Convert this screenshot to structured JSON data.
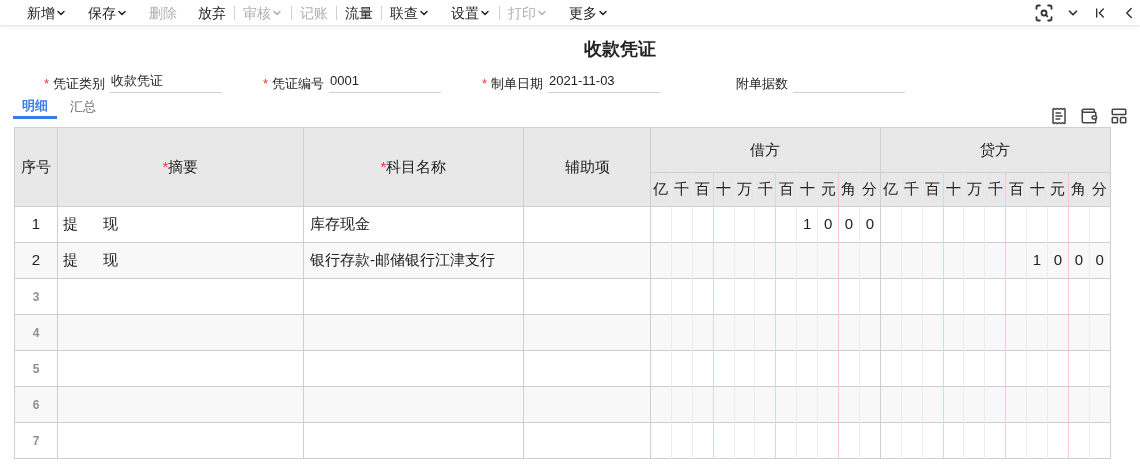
{
  "toolbar": [
    {
      "label": "新增",
      "caret": true,
      "disabled": false,
      "divider": false
    },
    {
      "label": "保存",
      "caret": true,
      "disabled": false,
      "divider": false
    },
    {
      "label": "删除",
      "caret": false,
      "disabled": true,
      "divider": false
    },
    {
      "label": "放弃",
      "caret": false,
      "disabled": false,
      "divider": false
    },
    {
      "label": "审核",
      "caret": true,
      "disabled": true,
      "divider": true
    },
    {
      "label": "记账",
      "caret": false,
      "disabled": true,
      "divider": true
    },
    {
      "label": "流量",
      "caret": false,
      "disabled": false,
      "divider": true
    },
    {
      "label": "联查",
      "caret": true,
      "disabled": false,
      "divider": true
    },
    {
      "label": "设置",
      "caret": true,
      "disabled": false,
      "divider": false
    },
    {
      "label": "打印",
      "caret": true,
      "disabled": true,
      "divider": true
    },
    {
      "label": "更多",
      "caret": true,
      "disabled": false,
      "divider": false
    }
  ],
  "title": "收款凭证",
  "fields": [
    {
      "mark": "*",
      "label": "凭证类别",
      "value": "收款凭证"
    },
    {
      "mark": "*",
      "label": "凭证编号",
      "value": "0001"
    },
    {
      "mark": "*",
      "label": "制单日期",
      "value": "2021-11-03"
    },
    {
      "label": "附单据数"
    }
  ],
  "tabs": [
    {
      "label": "明细",
      "selected": true
    },
    {
      "label": "汇总",
      "selected": false
    }
  ],
  "table": {
    "columns": [
      {
        "label": "序号"
      },
      {
        "mark": "*",
        "label": "摘要"
      },
      {
        "mark": "*",
        "label": "科目名称"
      },
      {
        "label": "辅助项"
      }
    ],
    "debit_header": "借方",
    "credit_header": "贷方",
    "digit_units": [
      "亿",
      "千",
      "百",
      "十",
      "万",
      "千",
      "百",
      "十",
      "元",
      "角",
      "分"
    ],
    "digit_units_credit": [
      "亿",
      "千",
      "百",
      "十",
      "万",
      "千",
      "百",
      "十",
      "元",
      "角",
      "分"
    ],
    "rows": [
      {
        "no": "1",
        "summary": "提      现",
        "account": "库存现金",
        "debit": [
          "1",
          "0",
          "0",
          "0"
        ]
      },
      {
        "no": "2",
        "summary": "提      现",
        "account": "银行存款-邮储银行江津支行",
        "credit": [
          "1",
          "0",
          "0",
          "0"
        ]
      },
      {
        "no": "3"
      },
      {
        "no": "4"
      },
      {
        "no": "5"
      },
      {
        "no": "6"
      },
      {
        "no": "7"
      }
    ]
  }
}
